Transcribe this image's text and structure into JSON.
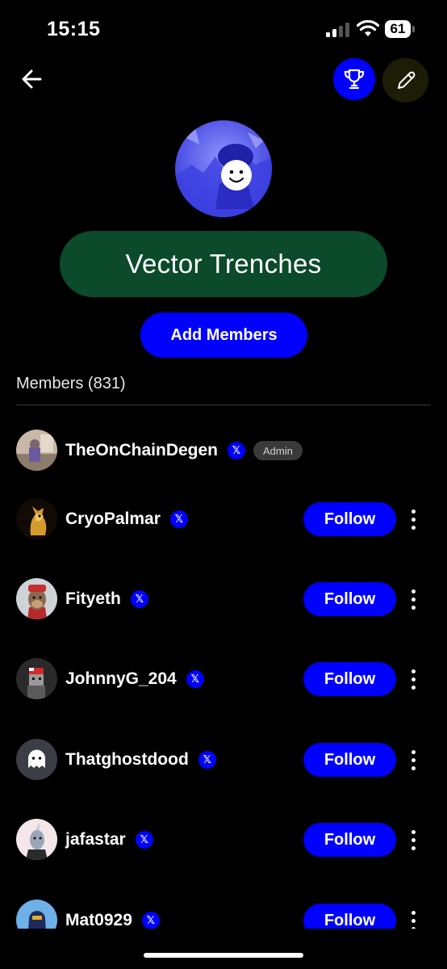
{
  "status": {
    "time": "15:15",
    "battery": "61"
  },
  "header": {
    "back_icon": "arrow-left-icon",
    "trophy_icon": "trophy-icon",
    "edit_icon": "pencil-icon"
  },
  "group": {
    "name": "Vector Trenches",
    "add_members_label": "Add Members"
  },
  "members": {
    "heading": "Members (831)",
    "follow_label": "Follow",
    "admin_label": "Admin",
    "x_badge": "𝕏",
    "list": [
      {
        "name": "TheOnChainDegen",
        "admin": true
      },
      {
        "name": "CryoPalmar",
        "admin": false
      },
      {
        "name": "Fityeth",
        "admin": false
      },
      {
        "name": "JohnnyG_204",
        "admin": false
      },
      {
        "name": "Thatghostdood",
        "admin": false
      },
      {
        "name": "jafastar",
        "admin": false
      },
      {
        "name": "Mat0929",
        "admin": false
      }
    ]
  },
  "colors": {
    "accent": "#0000ff",
    "group_pill": "#0b4a2a",
    "background": "#000000"
  }
}
